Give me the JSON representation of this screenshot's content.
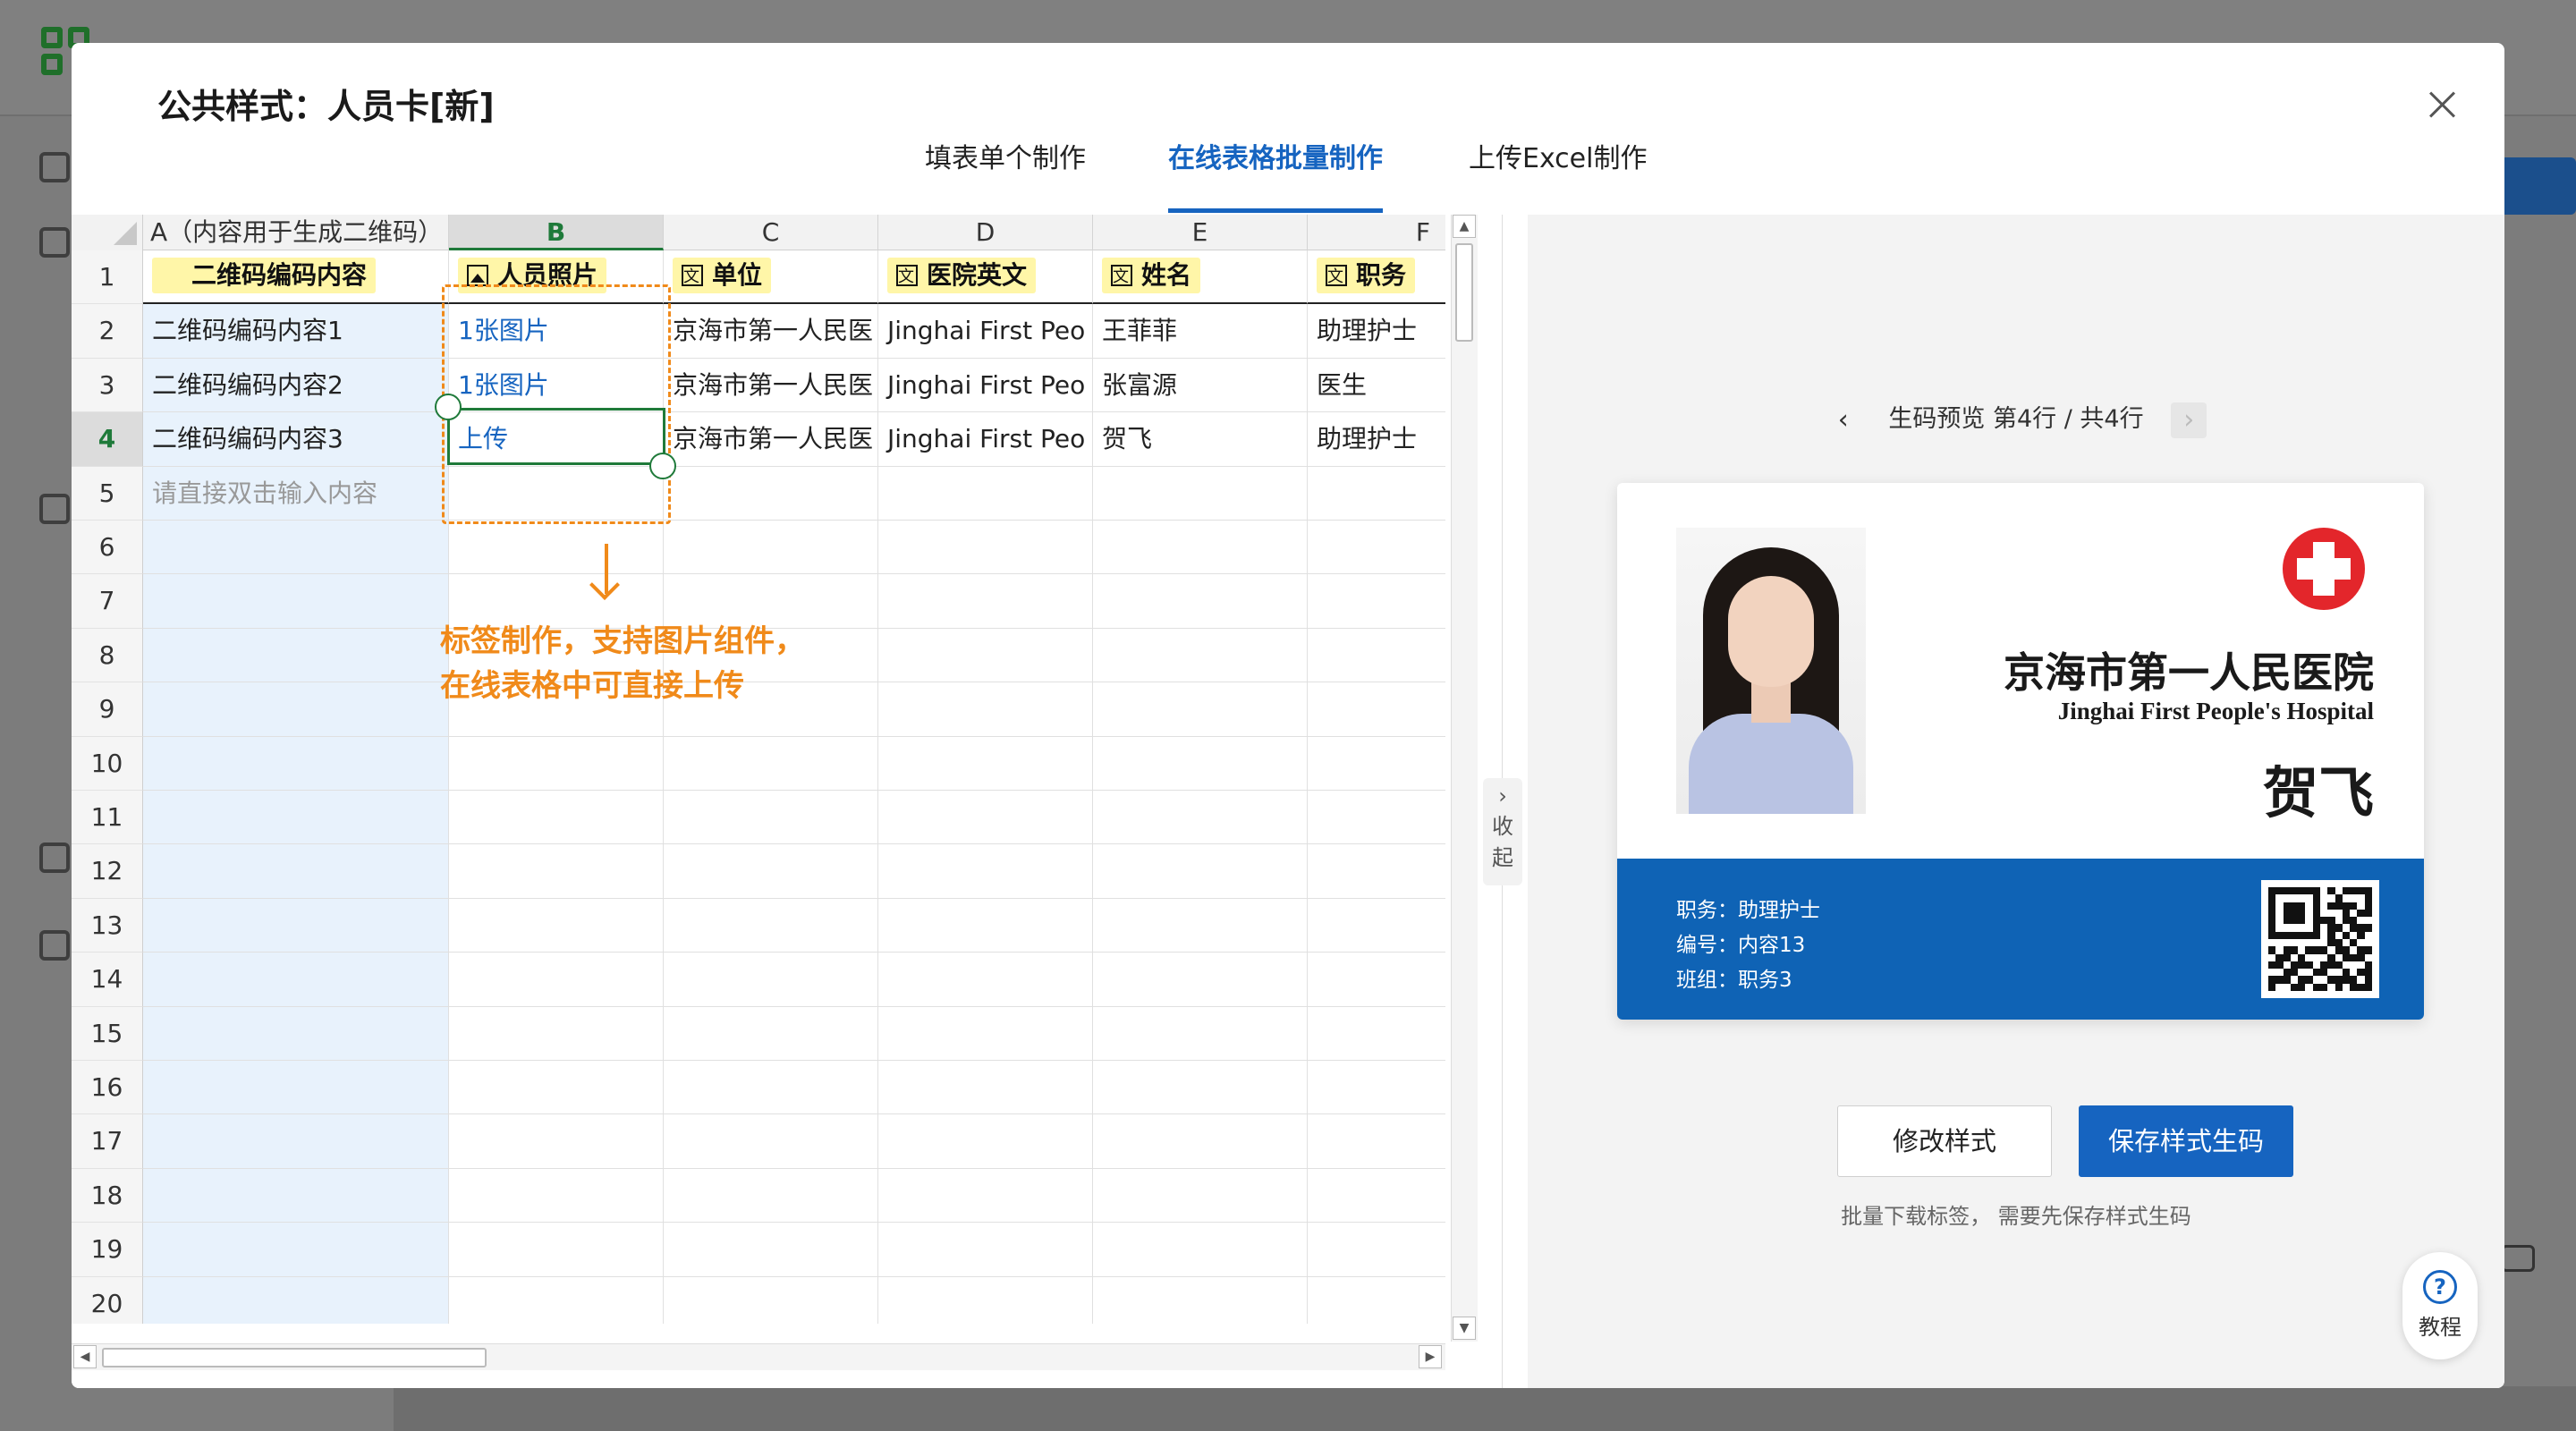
{
  "modal": {
    "title": "公共样式：人员卡[新]",
    "tabs": [
      {
        "label": "填表单个制作"
      },
      {
        "label": "在线表格批量制作"
      },
      {
        "label": "上传Excel制作"
      }
    ],
    "active_tab": 1
  },
  "sheet": {
    "columns": [
      "A（内容用于生成二维码）",
      "B",
      "C",
      "D",
      "E",
      "F"
    ],
    "selected_column": "B",
    "header_row": [
      {
        "icon": "qr-code-icon",
        "label": "二维码编码内容"
      },
      {
        "icon": "image-icon",
        "label": "人员照片"
      },
      {
        "icon": "text-icon",
        "label": "单位"
      },
      {
        "icon": "text-icon",
        "label": "医院英文"
      },
      {
        "icon": "text-icon",
        "label": "姓名"
      },
      {
        "icon": "text-icon",
        "label": "职务"
      }
    ],
    "rows": [
      [
        "二维码编码内容1",
        "1张图片",
        "京海市第一人民医",
        "Jinghai First Peo",
        "王菲菲",
        "助理护士"
      ],
      [
        "二维码编码内容2",
        "1张图片",
        "京海市第一人民医",
        "Jinghai First Peo",
        "张富源",
        "医生"
      ],
      [
        "二维码编码内容3",
        "上传",
        "京海市第一人民医",
        "Jinghai First Peo",
        "贺飞",
        "助理护士"
      ]
    ],
    "input_hint": "请直接双击输入内容",
    "row_numbers": [
      "1",
      "2",
      "3",
      "4",
      "5",
      "6",
      "7",
      "8",
      "9",
      "10",
      "11",
      "12",
      "13",
      "14",
      "15",
      "16",
      "17",
      "18",
      "19",
      "20"
    ],
    "selected_row": "4",
    "annotation": [
      "标签制作，支持图片组件，",
      "在线表格中可直接上传"
    ],
    "collapse_label": [
      "收",
      "起"
    ]
  },
  "preview": {
    "pager_text": "生码预览 第4行 / 共4行",
    "card": {
      "hospital_cn": "京海市第一人民医院",
      "hospital_en": "Jinghai First People's Hospital",
      "name": "贺飞",
      "lines": [
        "职务：助理护士",
        "编号：内容13",
        "班组：职务3"
      ],
      "band_color": "#0f63b5"
    },
    "edit_button": "修改样式",
    "save_button": "保存样式生码",
    "tip": "批量下载标签， 需要先保存样式生码"
  },
  "help": {
    "label": "教程"
  },
  "colors": {
    "accent": "#1664c0",
    "select_green": "#1f7a3a",
    "annotation_orange": "#f08a1a",
    "header_yellow": "#fff6a8"
  }
}
